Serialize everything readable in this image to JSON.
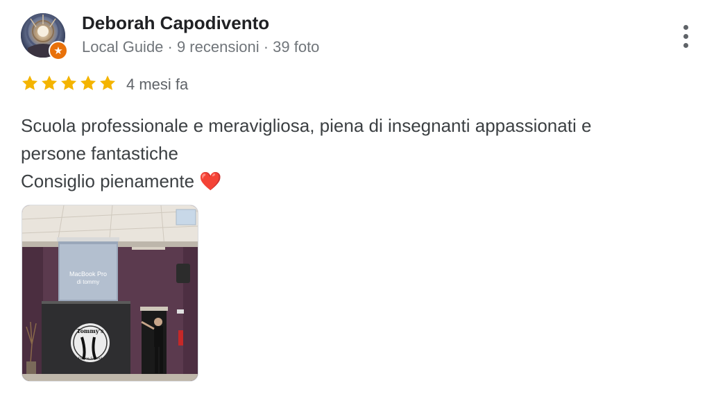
{
  "review": {
    "author": {
      "name": "Deborah Capodivento",
      "meta": "Local Guide · 9 recensioni · 39 foto",
      "badge_icon": "★"
    },
    "rating": 5,
    "rating_max": 5,
    "date": "4 mesi fa",
    "text_lines": [
      "Scuola professionale e meravigliosa, piena di insegnanti appassionati e",
      "persone fantastiche",
      "Consiglio pienamente ❤️"
    ],
    "photo": {
      "screen_line1": "MacBook Pro",
      "screen_line2": "di tommy",
      "logo_text": "Tommy's",
      "logo_sub": "Dance School"
    }
  },
  "colors": {
    "star": "#f4b400",
    "badge": "#e8710a",
    "name": "#202124",
    "meta": "#70757a"
  },
  "icons": {
    "more": "more-vertical-icon",
    "star": "star-icon",
    "badge": "local-guide-badge-icon"
  }
}
